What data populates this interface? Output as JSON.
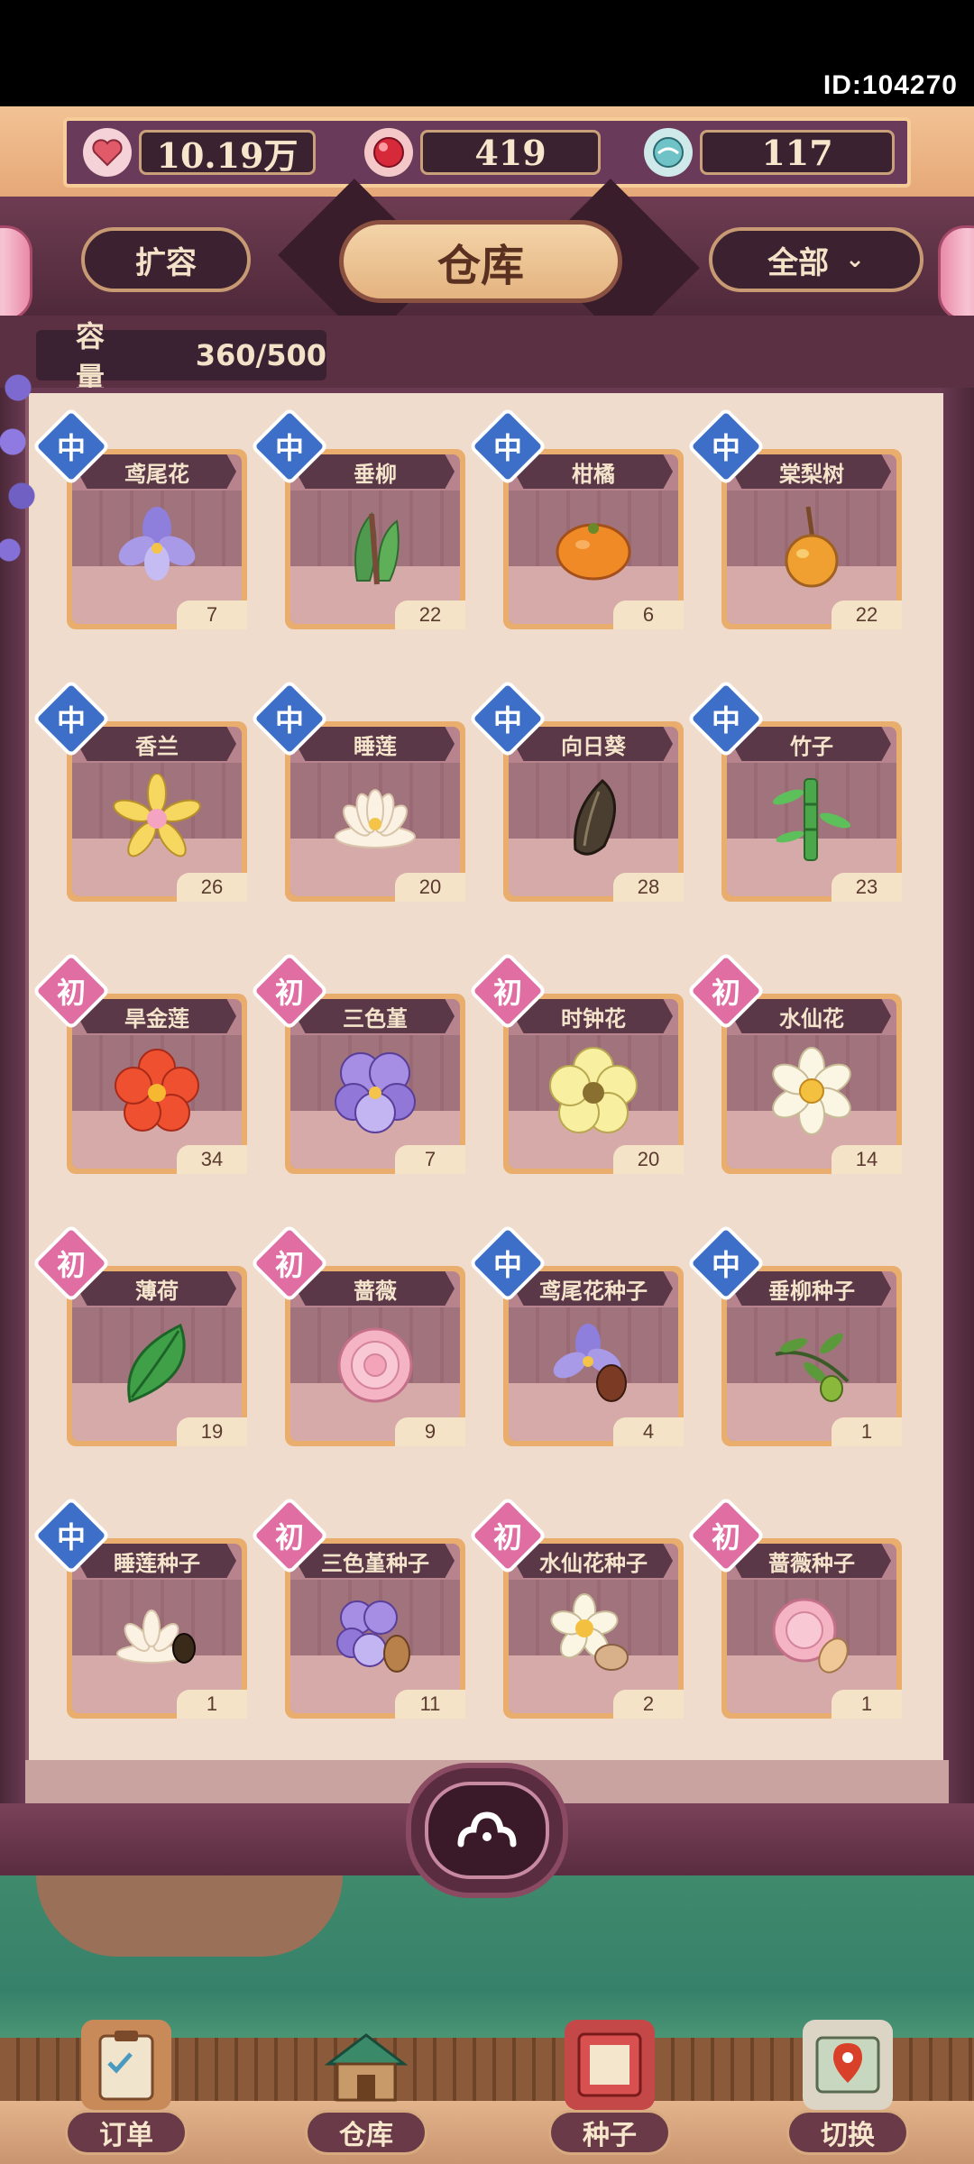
{
  "id_label": "ID:104270",
  "resources": [
    {
      "icon": "heart-flower-icon",
      "value": "10.19万"
    },
    {
      "icon": "red-gem-icon",
      "value": "419"
    },
    {
      "icon": "teal-orb-icon",
      "value": "117"
    }
  ],
  "toolbar": {
    "expand_label": "扩容",
    "title": "仓库",
    "filter_label": "全部"
  },
  "capacity": {
    "label": "容量",
    "value": "360/500"
  },
  "items": [
    {
      "name": "鸢尾花",
      "count": "7",
      "tier": "中",
      "icon": "iris-flower-icon"
    },
    {
      "name": "垂柳",
      "count": "22",
      "tier": "中",
      "icon": "willow-leaf-icon"
    },
    {
      "name": "柑橘",
      "count": "6",
      "tier": "中",
      "icon": "orange-fruit-icon"
    },
    {
      "name": "棠梨树",
      "count": "22",
      "tier": "中",
      "icon": "pear-fruit-icon"
    },
    {
      "name": "香兰",
      "count": "26",
      "tier": "中",
      "icon": "vanilla-flower-icon"
    },
    {
      "name": "睡莲",
      "count": "20",
      "tier": "中",
      "icon": "water-lily-icon"
    },
    {
      "name": "向日葵",
      "count": "28",
      "tier": "中",
      "icon": "sunflower-seed-icon"
    },
    {
      "name": "竹子",
      "count": "23",
      "tier": "中",
      "icon": "bamboo-icon"
    },
    {
      "name": "旱金莲",
      "count": "34",
      "tier": "初",
      "icon": "nasturtium-flower-icon"
    },
    {
      "name": "三色堇",
      "count": "7",
      "tier": "初",
      "icon": "pansy-flower-icon"
    },
    {
      "name": "时钟花",
      "count": "20",
      "tier": "初",
      "icon": "clock-flower-icon"
    },
    {
      "name": "水仙花",
      "count": "14",
      "tier": "初",
      "icon": "daffodil-flower-icon"
    },
    {
      "name": "薄荷",
      "count": "19",
      "tier": "初",
      "icon": "mint-leaf-icon"
    },
    {
      "name": "蔷薇",
      "count": "9",
      "tier": "初",
      "icon": "rose-flower-icon"
    },
    {
      "name": "鸢尾花种子",
      "count": "4",
      "tier": "中",
      "icon": "iris-seed-icon"
    },
    {
      "name": "垂柳种子",
      "count": "1",
      "tier": "中",
      "icon": "willow-seed-icon"
    },
    {
      "name": "睡莲种子",
      "count": "1",
      "tier": "中",
      "icon": "water-lily-seed-icon"
    },
    {
      "name": "三色堇种子",
      "count": "11",
      "tier": "初",
      "icon": "pansy-seed-icon"
    },
    {
      "name": "水仙花种子",
      "count": "2",
      "tier": "初",
      "icon": "daffodil-seed-icon"
    },
    {
      "name": "蔷薇种子",
      "count": "1",
      "tier": "初",
      "icon": "rose-seed-icon"
    }
  ],
  "bottom_nav": [
    {
      "label": "订单",
      "icon": "clipboard-icon"
    },
    {
      "label": "仓库",
      "icon": "warehouse-icon"
    },
    {
      "label": "种子",
      "icon": "seed-book-icon"
    },
    {
      "label": "切换",
      "icon": "map-pin-icon"
    }
  ]
}
